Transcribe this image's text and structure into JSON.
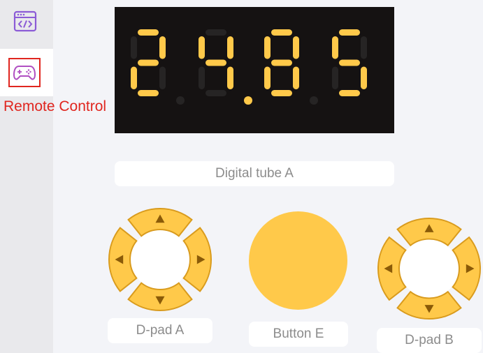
{
  "sidebar": {
    "code_tab": {
      "icon": "code-window-icon"
    },
    "remote_tab": {
      "icon": "gamepad-icon",
      "label": "Remote Control"
    }
  },
  "display": {
    "digits": [
      "2",
      "4",
      "8",
      "5"
    ],
    "decimal_point_after_digit": 2,
    "lit_color": "#ffc94a",
    "unlit_color": "#262424"
  },
  "labels": {
    "digital_tube": "Digital tube A",
    "dpad_a": "D-pad A",
    "button_e": "Button E",
    "dpad_b": "D-pad B"
  },
  "colors": {
    "accent": "#ffc94a",
    "label_text": "#8c8c8c",
    "active_tab_label": "#e0261f"
  }
}
